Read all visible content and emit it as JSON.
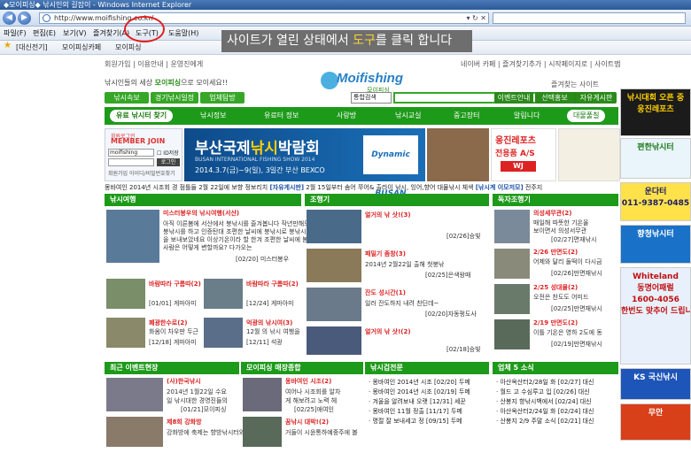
{
  "browser": {
    "title": "◆모이피싱◆ 낚시인의 길잡이 - Windows Internet Explorer",
    "url": "http://www.moifishing.co.kr/",
    "menu": [
      "파일(F)",
      "편집(E)",
      "보기(V)",
      "즐겨찾기(A)",
      "도구(T)",
      "도움말(H)"
    ],
    "favorites": [
      "[대신전기]",
      "모이피싱카페",
      "모이피싱"
    ]
  },
  "instruction": {
    "pre": "사이트가 열린 상태에서 ",
    "highlight": "도구",
    "post": "를 클릭 합니다"
  },
  "site": {
    "toplinks_left": "회원가입 | 이용안내 | 운영진에게",
    "toplinks_right": "네이버 카페 | 즐겨찾기추가 | 시작페이지로 | 사이트맵",
    "slogan_pre": "낚시인들의 세상 ",
    "slogan_brand": "모이피싱",
    "slogan_post": "으로 모이세요!!",
    "brand_sub": "모이피싱",
    "top_right_note": "즐겨찾는 사이트",
    "green_buttons": [
      "낚시속보",
      "경기낚시일정",
      "업체탐방"
    ],
    "search_select": "통합검색",
    "search_button": "검색",
    "right_buttons": [
      "이벤트안내",
      "선택홍보",
      "자유게시판"
    ],
    "nav": [
      "유료 낚시터 찾기",
      "낚시정보",
      "유료터 정보",
      "사랑방",
      "낚시교실",
      "중고장터",
      "알림니다",
      "대물풀칠"
    ],
    "login": {
      "title_small": "회원로그인",
      "title": "MEMBER JOIN",
      "id_value": "moifishing",
      "save_label": "ID저장",
      "login_button": "로그인",
      "links": "회원가입 아이디/비밀번호찾기"
    },
    "banner": {
      "line1_pre": "부산국제",
      "line1_hl": "낚시",
      "line1_post": "박람회",
      "line2": "BUSAN INTERNATIONAL FISHING SHOW 2014",
      "line3": "2014.3.7(금)~9(일), 3일간 부산 BEXCO",
      "logo": "Dynamic BUSAN"
    },
    "promo": {
      "name": "웅진레포츠",
      "sub": "전용품 A/S",
      "badge": "WJ"
    },
    "ticker": {
      "text1": "몽바여인 2014년 시조회 경 점틀들 2월 22일에 보향 정보리치",
      "hl1": "[자유게시판]",
      "text2": "2월 15일부터 솜어 쭈어& 출라이 낚시, 잉어,향어 대물낚시 체색",
      "hl2": "[낚시계 이모저모]",
      "text3": "전주지"
    },
    "sections": {
      "col1": {
        "header": "낚시여행",
        "lead_title": "미스터봉우의 낚시여행(서산)",
        "lead_body": [
          "아직 이른봄에 서산에서 붕낚시를 즐겨봅니다 작년만해도 어",
          "붕낚시를 하고 인증탄대 조편한 날씨에 붕낚시로 붕낚시로 봄",
          "을 보내보았네요 이상기온이라 할 한겨 조편한 날씨에 봄속",
          "사람은 어떻게 변할까요? 다가오는"
        ],
        "lead_meta": "[02/20] 미스터봉우",
        "items": [
          {
            "title": "바람따라 구름따",
            "count": "(2)",
            "meta": "[01/01] 게마아미"
          },
          {
            "title": "바람따라 구름따",
            "count": "(2)",
            "meta": "[12/24] 게마아미"
          },
          {
            "title": "폐광한수로",
            "count": "(2)",
            "body1": "화옴이 차우딴 두근",
            "meta": "[12/18] 게마아미"
          },
          {
            "title": "억광의 낚시여",
            "count": "(3)",
            "body1": "12월 의 낚시 여행을",
            "meta": "[12/11] 석광"
          }
        ]
      },
      "col2": {
        "header": "조행기",
        "items": [
          {
            "title": "얼거의 낚 삿!",
            "count": "(3)",
            "meta": "[02/26]승빛"
          },
          {
            "title": "패밀기 좀창",
            "count": "(3)",
            "body1": "2014년 2월22일 출해 첫붕낚",
            "meta": "[02/25]은색왕매"
          },
          {
            "title": "잔도 성시간",
            "count": "(1)",
            "body1": "일러 잔도하지 내려 찬딘데~",
            "meta": "[02/20]자동펑도사"
          },
          {
            "title": "얼거의 낚 삿!",
            "count": "(2)",
            "meta": "[02/18]승빛"
          }
        ]
      },
      "col3": {
        "header": "독자조행기",
        "items": [
          {
            "title": "의성세무관",
            "count": "(2)",
            "body1": "매일해 따뜻한 기온올",
            "body2": "보이면서 의성서무관",
            "meta": "[02/27]면재낚시"
          },
          {
            "title": "2/26 만면도",
            "count": "(2)",
            "body1": "어제와 달리 둘떡이 다시금",
            "meta": "[02/26]만면재낚시"
          },
          {
            "title": "2/25 성대물",
            "count": "(2)",
            "body1": "오전은 찬도도 어미드",
            "meta": "[02/25]만면재낚시"
          },
          {
            "title": "2/19 만면도",
            "count": "(2)",
            "body1": "이틀 기온은 영하 2도에 동",
            "meta": "[02/19]만면재낚시"
          }
        ]
      }
    },
    "bottom": {
      "headers": [
        "최근 이벤트현장",
        "모이피싱 매장종합",
        "낚시겁전문",
        "업체 5 소식"
      ],
      "evt": [
        {
          "title": "(사)한국낚시",
          "body1": "2014년 1월22일 수요",
          "body2": "일 낚시대한 경영진들의",
          "meta": "[01/21]모이피싱"
        },
        {
          "title": "제8회 강화방",
          "body1": "강화방에 축제는 향방낚시터와"
        }
      ],
      "shop": [
        {
          "title": "몽바여인 시조",
          "count": "(2)",
          "body1": "여어나 시조회를 알차",
          "body2": "게 해보려고 노력 헤",
          "meta": "[02/25]애여인"
        },
        {
          "title": "꿈낚시 대박!",
          "count": "(2)",
          "body1": "거들이 시윤통하예중주에 볼"
        }
      ],
      "list3": [
        {
          "t": "몽바여인 2014년 시조",
          "d": "[02/20]",
          "w": "두메"
        },
        {
          "t": "몽바여인 2014년 시조",
          "d": "[02/19]",
          "w": "두메"
        },
        {
          "t": "겨울을 알려보내 오랫",
          "d": "[12/31]",
          "w": "세꾼"
        },
        {
          "t": "몽바여인 11월 정출",
          "d": "[11/17]",
          "w": "두메"
        },
        {
          "t": "명절 잘 보내세고 정",
          "d": "[09/15]",
          "w": "두메"
        }
      ],
      "list4": [
        {
          "t": "아산옥산터2/28일 화",
          "d": "[02/27]",
          "w": "대신"
        },
        {
          "t": "월드 고 수심루고 입",
          "d": "[02/26]",
          "w": "대신"
        },
        {
          "t": "산봉지 향낚시백에서",
          "d": "[02/24]",
          "w": "대신"
        },
        {
          "t": "아산옥산터2/24일 화",
          "d": "[02/24]",
          "w": "대신"
        },
        {
          "t": "산봉지 2/9 주말 소식",
          "d": "[02/21]",
          "w": "대신"
        }
      ]
    },
    "side": [
      {
        "label": "낚시대회 오픈 중",
        "label2": "웅진레포츠",
        "bg": "#1b1b1b",
        "fg": "#ffd000"
      },
      {
        "label": "편한낚시터",
        "bg": "#e9f4fb",
        "fg": "#1a7a1a"
      },
      {
        "label": "운다터",
        "label2": "011-9387-0485",
        "bg": "#ffe24a",
        "fg": "#1a1a6a"
      },
      {
        "label": "향청낚시터",
        "bg": "#1a72c8",
        "fg": "#ffffff"
      },
      {
        "label": "Whiteland",
        "label2": "동명어패럴",
        "label3": "1600-4056",
        "label4": "한번도 맞추어 드립니다",
        "bg": "#e8f0fb",
        "fg": "#c01010"
      },
      {
        "label": "KS 국신낚시",
        "bg": "#1e55b8",
        "fg": "#ffffff"
      },
      {
        "label": "무안",
        "bg": "#d8401a",
        "fg": "#ffffff"
      }
    ],
    "colors": {
      "green": "#1e9a1a",
      "red": "#e02020",
      "accent_yellow": "#ffd23a"
    }
  }
}
